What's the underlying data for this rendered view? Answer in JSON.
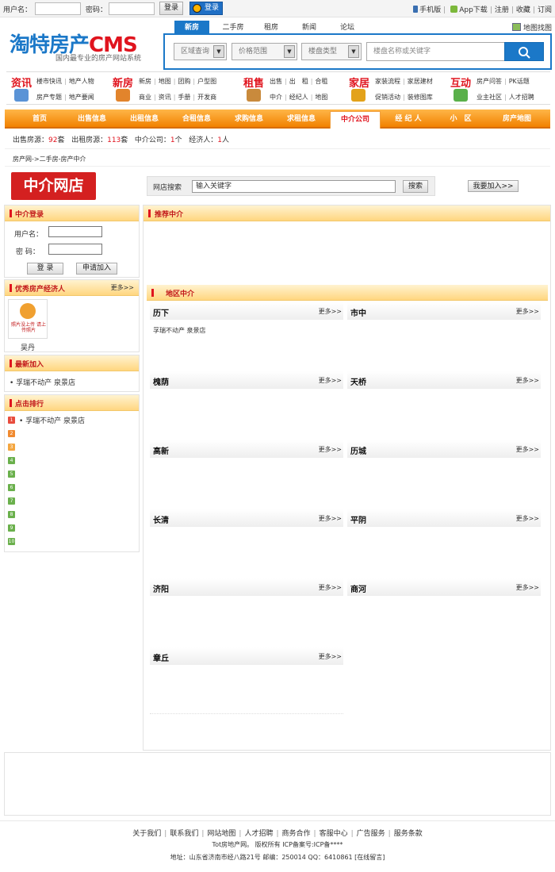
{
  "topbar": {
    "username_label": "用户名：",
    "password_label": "密码：",
    "login_btn": "登录",
    "qq_login": "登录",
    "links": [
      "手机版",
      "App下载",
      "注册",
      "收藏",
      "订阅"
    ]
  },
  "logo": {
    "main": "淘特房产",
    "cms": "CMS",
    "slogan": "国内最专业的房产网站系统"
  },
  "search": {
    "tabs": [
      "新房",
      "二手房",
      "租房",
      "新闻",
      "论坛"
    ],
    "active_tab": "新房",
    "filters": [
      "区域查询",
      "价格范围",
      "楼盘类型"
    ],
    "placeholder": "楼盘名称或关键字",
    "map_find": "地图找图"
  },
  "navgrid": {
    "groups": [
      {
        "title": "资讯",
        "row1": [
          "楼市快讯",
          "地产人物"
        ],
        "row2": [
          "房产专题",
          "地产要闻"
        ]
      },
      {
        "title": "新房",
        "row1": [
          "新房",
          "地图",
          "团购",
          "户型图"
        ],
        "row2": [
          "商业",
          "资讯",
          "手册",
          "开发商"
        ]
      },
      {
        "title": "租售",
        "row1": [
          "出售",
          "出",
          "租",
          "合租"
        ],
        "row2": [
          "中介",
          "经纪人",
          "地图"
        ]
      },
      {
        "title": "家居",
        "row1": [
          "家装流程",
          "家居建材"
        ],
        "row2": [
          "促销活动",
          "装修图库"
        ]
      },
      {
        "title": "互动",
        "row1": [
          "房产问答",
          "PK话题"
        ],
        "row2": [
          "业主社区",
          "人才招聘"
        ]
      }
    ]
  },
  "menu": {
    "items": [
      "首页",
      "出售信息",
      "出租信息",
      "合租信息",
      "求购信息",
      "求租信息",
      "中介公司",
      "经 纪 人",
      "小　区",
      "房产地图"
    ],
    "active": "中介公司"
  },
  "stats": {
    "sale_label": "出售房源：",
    "sale": "92",
    "sale_unit": "套",
    "rent_label": "出租房源：",
    "rent": "113",
    "rent_unit": "套",
    "agency_label": "中介公司：",
    "agency": "1",
    "agency_unit": "个",
    "broker_label": "经济人：",
    "broker": "1",
    "broker_unit": "人"
  },
  "breadcrumb": "房产网->二手房-房产中介",
  "shop": {
    "logo_text": "中介网店",
    "search_label": "网店搜索",
    "search_value": "输入关键字",
    "search_btn": "搜索",
    "join_btn": "我要加入>>"
  },
  "sidebar": {
    "login": {
      "title": "中介登录",
      "user_label": "用户名：",
      "pass_label": "密  码：",
      "login_btn": "登 录",
      "apply_btn": "申请加入"
    },
    "brokers": {
      "title": "优秀房产经济人",
      "more": "更多>>",
      "photo_text": "照片没上传 请上传照片",
      "name": "吴丹"
    },
    "newest": {
      "title": "最新加入",
      "items": [
        "• 孚瑞不动产 泉景店"
      ]
    },
    "ranking": {
      "title": "点击排行",
      "items": [
        "• 孚瑞不动产 泉景店",
        "",
        "",
        "",
        "",
        "",
        "",
        "",
        "",
        ""
      ],
      "numbers": [
        "1",
        "2",
        "3",
        "4",
        "5",
        "6",
        "7",
        "8",
        "9",
        "10"
      ]
    }
  },
  "main": {
    "recommend_title": "推荐中介",
    "area_title": "地区中介",
    "more": "更多>>",
    "areas": [
      {
        "name": "历下",
        "items": [
          "孚瑞不动产 泉景店"
        ]
      },
      {
        "name": "市中",
        "items": []
      },
      {
        "name": "槐荫",
        "items": []
      },
      {
        "name": "天桥",
        "items": []
      },
      {
        "name": "高新",
        "items": []
      },
      {
        "name": "历城",
        "items": []
      },
      {
        "name": "长清",
        "items": []
      },
      {
        "name": "平阴",
        "items": []
      },
      {
        "name": "济阳",
        "items": []
      },
      {
        "name": "商河",
        "items": []
      },
      {
        "name": "章丘",
        "items": []
      }
    ]
  },
  "footer": {
    "links": [
      "关于我们",
      "联系我们",
      "网站地图",
      "人才招聘",
      "商务合作",
      "客服中心",
      "广告服务",
      "服务条款"
    ],
    "copyright": "Tot房地产网。 版权所有 ICP备案号:ICP备****",
    "address": "地址：山东省济南市经八路21号 邮编：250014 QQ：6410861 [在线留言]"
  },
  "colors": {
    "brand_blue": "#1b78c8",
    "brand_red": "#e0141e",
    "menu_orange": "#f18100"
  }
}
